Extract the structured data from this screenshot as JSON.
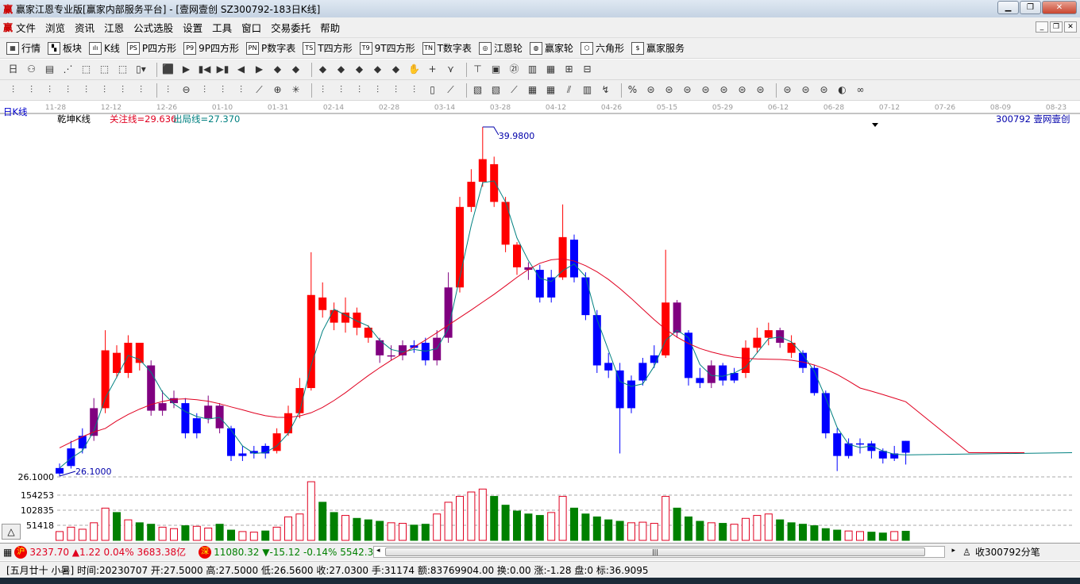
{
  "window": {
    "title": "赢家江恩专业版[赢家内部服务平台] - [壹网壹创  SZ300792-183日K线]",
    "logo": "赢"
  },
  "menu": [
    "文件",
    "浏览",
    "资讯",
    "江恩",
    "公式选股",
    "设置",
    "工具",
    "窗口",
    "交易委托",
    "帮助"
  ],
  "toolbar1": [
    {
      "icon": "grid-icon",
      "g": "▦",
      "label": "行情"
    },
    {
      "icon": "blocks-icon",
      "g": "▚",
      "label": "板块"
    },
    {
      "icon": "kline-icon",
      "g": "ılı",
      "label": "K线"
    },
    {
      "icon": "ps-icon",
      "g": "PS",
      "label": "P四方形"
    },
    {
      "icon": "p9-icon",
      "g": "P9",
      "label": "9P四方形"
    },
    {
      "icon": "pn-icon",
      "g": "PN",
      "label": "P数字表"
    },
    {
      "icon": "ts-icon",
      "g": "TS",
      "label": "T四方形"
    },
    {
      "icon": "t9-icon",
      "g": "T9",
      "label": "9T四方形"
    },
    {
      "icon": "tn-icon",
      "g": "TN",
      "label": "T数字表"
    },
    {
      "icon": "gann-wheel-icon",
      "g": "◎",
      "label": "江恩轮"
    },
    {
      "icon": "winner-wheel-icon",
      "g": "◍",
      "label": "赢家轮"
    },
    {
      "icon": "hexagon-icon",
      "g": "⬡",
      "label": "六角形"
    },
    {
      "icon": "dollar-icon",
      "g": "$",
      "label": "赢家服务"
    }
  ],
  "toolbar2": [
    "日▾",
    "⚇",
    "▤",
    "⋰",
    "⬚",
    "⬚",
    "⬚",
    "▯▾",
    "⬛",
    "▶",
    "▮◀",
    "▶▮",
    "◀",
    "▶",
    "◆",
    "◆",
    "◆",
    "◆",
    "◆",
    "◆",
    "◆",
    "✋",
    "+",
    "⋎",
    "⊤",
    "▣",
    "㉑",
    "▥",
    "▦",
    "⊞",
    "⊟"
  ],
  "toolbar3": [
    "⫶",
    "⫶",
    "⫶",
    "⫶",
    "⫶",
    "⫶",
    "⫶",
    "⫶",
    "⫶",
    "⊖",
    "⫶",
    "⫶",
    "⫶",
    "⟋",
    "⊕",
    "✳",
    "⫶",
    "⫶",
    "⫶",
    "⫶",
    "⫶",
    "⫶",
    "▯",
    "⟋",
    "▧",
    "▧",
    "⟋",
    "▦",
    "▦",
    "⫽",
    "▥",
    "↯",
    "%",
    "⊜",
    "⊜",
    "⊜",
    "⊜",
    "⊜",
    "⊜",
    "⊜",
    "⊜",
    "⊜",
    "⊜",
    "◐",
    "∞"
  ],
  "chart": {
    "period_label": "日K线",
    "indicator_name": "乾坤K线",
    "focus_line": "关注线=29.636",
    "exit_line": "出局线=27.370",
    "stock": "300792  壹网壹创",
    "high_label": "39.9800",
    "low_label": "26.1000",
    "price_axis_low": "26.1000",
    "vol_ticks": [
      "154253",
      "102835",
      "51418"
    ],
    "dates": [
      "11-28",
      "12-12",
      "12-26",
      "01-10",
      "01-31",
      "02-14",
      "02-28",
      "03-14",
      "03-28",
      "04-12",
      "04-26",
      "05-15",
      "05-29",
      "06-12",
      "06-28",
      "07-12",
      "07-26",
      "08-09",
      "08-23"
    ]
  },
  "chart_data": {
    "type": "candlestick",
    "price_range": [
      26.1,
      39.98
    ],
    "vol_ticks": [
      154253,
      102835,
      51418
    ],
    "closes": [
      26.42,
      27.2,
      27.7,
      28.8,
      31.1,
      30.2,
      31.4,
      30.6,
      28.7,
      29.0,
      29.2,
      27.8,
      28.4,
      28.9,
      28.0,
      26.9,
      27.0,
      27.1,
      27.0,
      27.8,
      28.6,
      29.6,
      33.3,
      32.7,
      32.2,
      32.6,
      32.0,
      31.6,
      30.9,
      30.9,
      31.3,
      31.2,
      30.7,
      31.6,
      33.6,
      36.8,
      37.8,
      38.7,
      37.0,
      35.3,
      34.4,
      34.3,
      33.2,
      34.0,
      35.6,
      34.0,
      32.5,
      30.5,
      30.3,
      28.8,
      29.9,
      30.6,
      30.9,
      33.0,
      31.8,
      30.0,
      29.8,
      30.5,
      29.9,
      30.2,
      31.2,
      31.6,
      31.9,
      31.4,
      31.0,
      30.4,
      29.4,
      27.8,
      26.9,
      27.4,
      27.4,
      27.1,
      26.8,
      27.0,
      27.03
    ],
    "opens": [
      26.2,
      26.5,
      27.2,
      27.7,
      28.8,
      31.0,
      30.2,
      31.4,
      30.5,
      28.7,
      29.0,
      29.0,
      27.8,
      28.4,
      28.9,
      28.0,
      26.9,
      27.0,
      27.3,
      27.1,
      27.8,
      28.6,
      29.6,
      33.2,
      32.7,
      32.2,
      32.6,
      32.0,
      31.5,
      30.9,
      30.9,
      31.3,
      31.4,
      30.7,
      31.6,
      33.6,
      36.8,
      37.8,
      38.5,
      37.0,
      35.3,
      34.4,
      34.3,
      33.2,
      34.0,
      35.5,
      34.0,
      32.5,
      30.6,
      30.3,
      28.8,
      29.9,
      30.6,
      30.9,
      33.0,
      31.8,
      30.0,
      29.8,
      30.5,
      29.9,
      30.2,
      31.2,
      31.6,
      31.9,
      31.4,
      31.0,
      30.4,
      29.4,
      27.8,
      26.9,
      27.4,
      27.4,
      27.1,
      26.8,
      27.5
    ],
    "highs": [
      26.6,
      27.5,
      28.0,
      29.2,
      31.9,
      31.3,
      31.7,
      31.0,
      30.7,
      29.5,
      29.5,
      29.2,
      28.6,
      29.3,
      29.0,
      28.1,
      27.3,
      27.3,
      27.4,
      28.0,
      28.9,
      30.0,
      35.0,
      33.8,
      33.0,
      33.2,
      32.8,
      32.1,
      31.6,
      31.3,
      31.5,
      31.5,
      31.6,
      31.9,
      34.2,
      37.2,
      38.3,
      39.98,
      38.8,
      37.2,
      35.4,
      34.6,
      34.5,
      34.3,
      36.9,
      35.7,
      34.2,
      32.7,
      31.0,
      30.6,
      30.1,
      30.8,
      31.3,
      35.1,
      33.1,
      31.9,
      30.4,
      30.7,
      30.6,
      30.4,
      31.5,
      32.0,
      32.2,
      32.0,
      31.7,
      31.1,
      30.5,
      29.5,
      28.0,
      27.6,
      27.6,
      27.5,
      27.2,
      27.3,
      27.5
    ],
    "lows": [
      26.1,
      26.4,
      27.0,
      27.5,
      28.6,
      30.0,
      30.0,
      30.3,
      28.5,
      28.5,
      28.8,
      27.6,
      27.6,
      28.2,
      27.8,
      26.7,
      26.7,
      26.8,
      26.8,
      27.0,
      27.7,
      28.4,
      29.5,
      32.4,
      31.9,
      31.8,
      31.7,
      31.4,
      30.6,
      30.7,
      30.7,
      31.0,
      30.5,
      30.5,
      31.4,
      33.4,
      36.6,
      37.6,
      36.8,
      35.0,
      34.1,
      33.9,
      33.0,
      33.0,
      33.9,
      33.8,
      32.3,
      30.2,
      30.0,
      27.0,
      28.6,
      29.7,
      30.4,
      30.8,
      31.6,
      29.7,
      29.6,
      29.6,
      29.7,
      29.8,
      30.0,
      31.0,
      31.3,
      31.2,
      30.8,
      30.2,
      29.3,
      27.6,
      26.3,
      26.8,
      27.0,
      26.8,
      26.6,
      26.7,
      26.56
    ],
    "kinds": [
      "b",
      "b",
      "b",
      "p",
      "r",
      "r",
      "r",
      "r",
      "p",
      "p",
      "p",
      "b",
      "b",
      "p",
      "p",
      "b",
      "b",
      "b",
      "b",
      "r",
      "r",
      "r",
      "r",
      "r",
      "r",
      "r",
      "r",
      "r",
      "p",
      "p",
      "p",
      "b",
      "b",
      "p",
      "p",
      "r",
      "r",
      "r",
      "r",
      "r",
      "r",
      "p",
      "b",
      "b",
      "r",
      "b",
      "b",
      "b",
      "b",
      "b",
      "b",
      "b",
      "b",
      "r",
      "p",
      "b",
      "b",
      "p",
      "b",
      "b",
      "r",
      "r",
      "r",
      "p",
      "r",
      "b",
      "b",
      "b",
      "b",
      "b",
      "b",
      "b",
      "b",
      "b",
      "b"
    ],
    "volumes": [
      30000,
      45000,
      38000,
      60000,
      110000,
      95000,
      70000,
      60000,
      55000,
      45000,
      40000,
      50000,
      48000,
      42000,
      55000,
      35000,
      30000,
      28000,
      32000,
      45000,
      80000,
      90000,
      200000,
      130000,
      95000,
      85000,
      75000,
      70000,
      65000,
      60000,
      58000,
      52000,
      55000,
      90000,
      130000,
      150000,
      165000,
      175000,
      150000,
      120000,
      100000,
      90000,
      85000,
      95000,
      150000,
      110000,
      90000,
      80000,
      70000,
      65000,
      60000,
      62000,
      58000,
      150000,
      110000,
      80000,
      65000,
      60000,
      58000,
      55000,
      75000,
      85000,
      90000,
      70000,
      60000,
      55000,
      50000,
      40000,
      35000,
      32000,
      30000,
      28000,
      25000,
      30000,
      31174
    ]
  },
  "status": {
    "sh_index": "3237.70",
    "sh_change": "▲1.22 0.04% 3683.38亿",
    "sz_index": "11080.32",
    "sz_change": "▼-15.12 -0.14% 5542.3",
    "sh_badge": "沪",
    "sz_badge": "深",
    "collect": "收300792分笔",
    "info": "[五月廿十 小暑] 时间:20230707 开:27.5000 高:27.5000 低:26.5600 收:27.0300 手:31174 额:83769904.00 换:0.00 涨:-1.28 盘:0 标:36.9095"
  }
}
